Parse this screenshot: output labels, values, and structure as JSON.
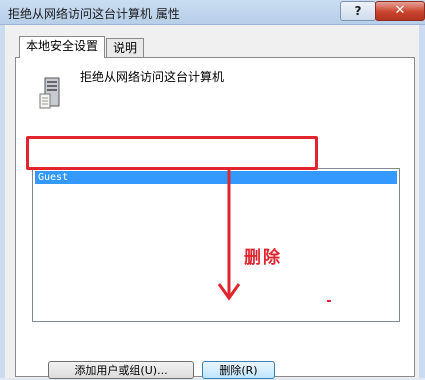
{
  "window": {
    "title": "拒绝从网络访问这台计算机 属性",
    "help_label": "?",
    "close_label": "✕"
  },
  "tabs": [
    {
      "label": "本地安全设置",
      "active": true
    },
    {
      "label": "说明",
      "active": false
    }
  ],
  "policy": {
    "icon": "computer-tower-icon",
    "title": "拒绝从网络访问这台计算机"
  },
  "accounts": {
    "items": [
      {
        "label": "Guest",
        "selected": true
      }
    ]
  },
  "buttons": {
    "add_label": "添加用户或组(U)...",
    "remove_label": "删除(R)"
  },
  "annotation": {
    "text": "删除",
    "color": "#e0252f"
  },
  "colors": {
    "selection": "#3399ff",
    "titlebar": "#c9dcf2"
  }
}
